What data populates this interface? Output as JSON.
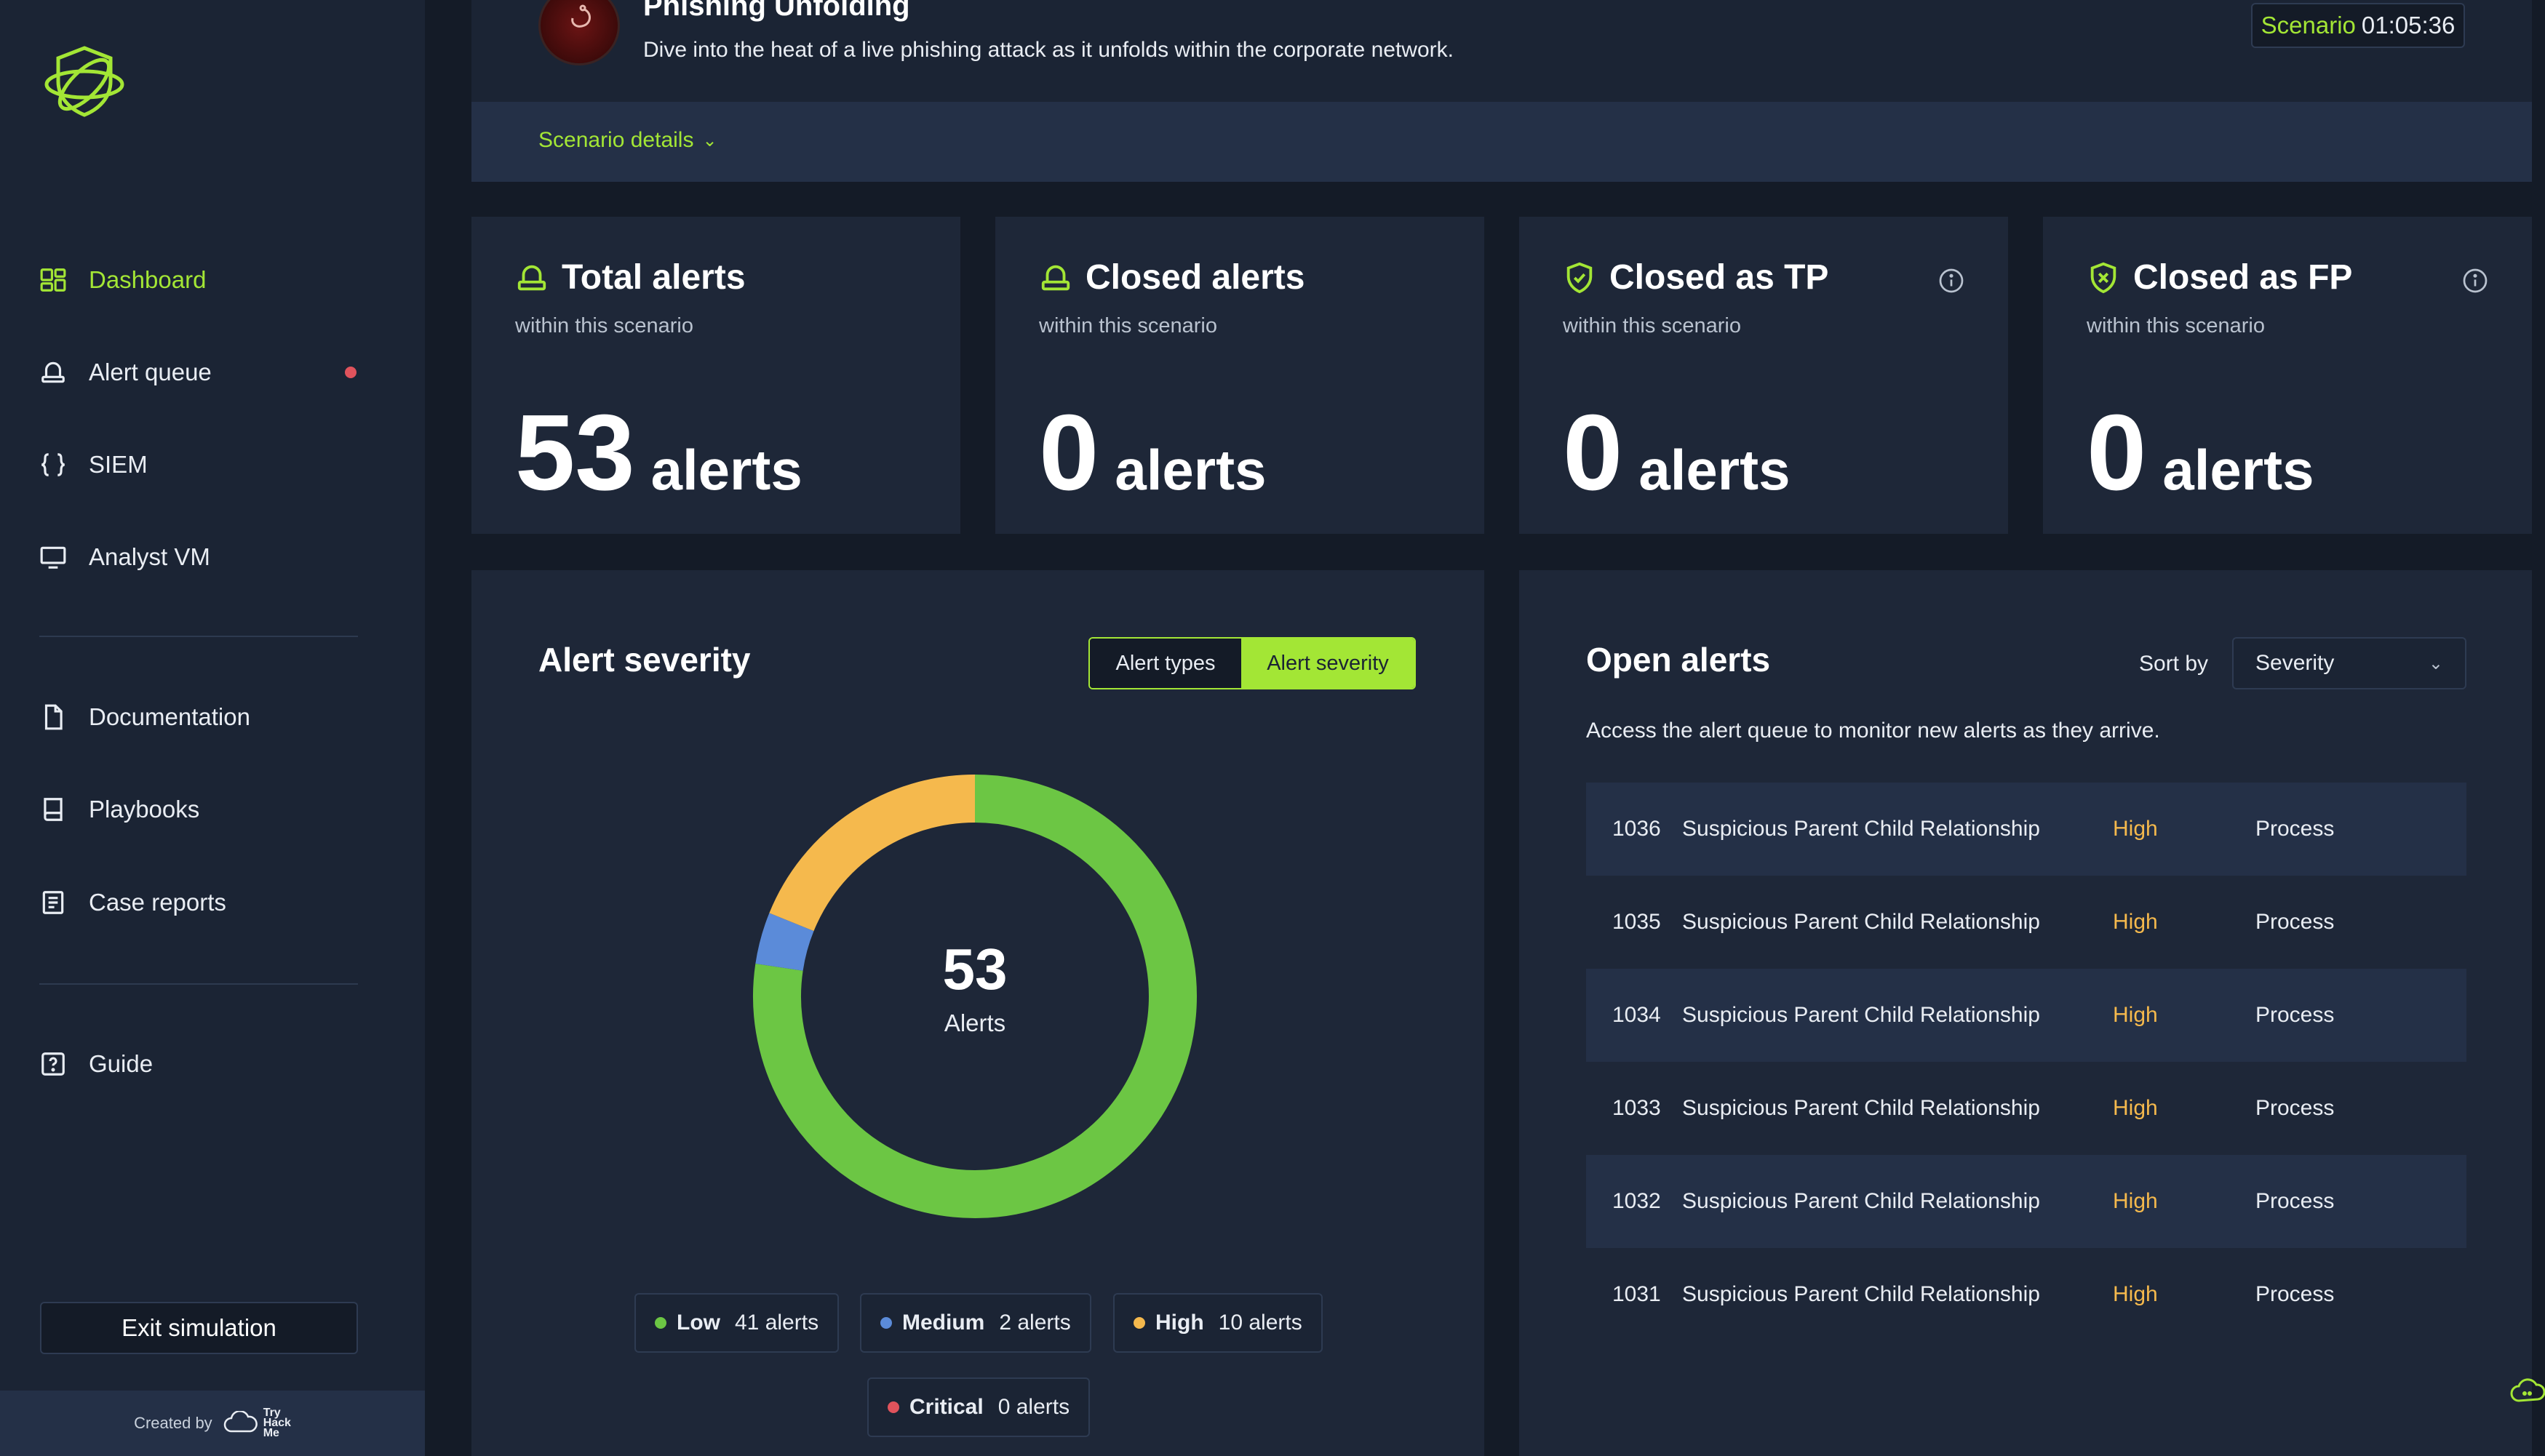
{
  "sidebar": {
    "nav_primary": [
      {
        "label": "Dashboard",
        "icon": "dashboard-icon",
        "active": true
      },
      {
        "label": "Alert queue",
        "icon": "alert-queue-icon",
        "notify": true
      },
      {
        "label": "SIEM",
        "icon": "braces-icon"
      },
      {
        "label": "Analyst VM",
        "icon": "monitor-icon"
      }
    ],
    "nav_secondary": [
      {
        "label": "Documentation",
        "icon": "document-icon"
      },
      {
        "label": "Playbooks",
        "icon": "book-icon"
      },
      {
        "label": "Case reports",
        "icon": "report-icon"
      }
    ],
    "nav_tertiary": [
      {
        "label": "Guide",
        "icon": "help-icon"
      }
    ],
    "exit_label": "Exit simulation",
    "footer_created_by": "Created by",
    "footer_brand": [
      "Try",
      "Hack",
      "Me"
    ]
  },
  "header": {
    "scenario_title": "Phishing Unfolding",
    "scenario_description": "Dive into the heat of a live phishing attack as it unfolds within the corporate network.",
    "timer_label": "Scenario",
    "timer_value": "01:05:36",
    "details_label": "Scenario details"
  },
  "stats": [
    {
      "title": "Total alerts",
      "subtitle": "within this scenario",
      "value": "53",
      "unit": "alerts",
      "icon": "alert-light-icon",
      "info": false
    },
    {
      "title": "Closed alerts",
      "subtitle": "within this scenario",
      "value": "0",
      "unit": "alerts",
      "icon": "alert-light-icon",
      "info": false
    },
    {
      "title": "Closed as TP",
      "subtitle": "within this scenario",
      "value": "0",
      "unit": "alerts",
      "icon": "shield-check-icon",
      "info": true
    },
    {
      "title": "Closed as FP",
      "subtitle": "within this scenario",
      "value": "0",
      "unit": "alerts",
      "icon": "shield-x-icon",
      "info": true
    }
  ],
  "severity_panel": {
    "title": "Alert severity",
    "toggle_options": [
      "Alert types",
      "Alert severity"
    ],
    "toggle_selected": "Alert severity",
    "center_value": "53",
    "center_label": "Alerts"
  },
  "chart_data": {
    "type": "pie",
    "total": 53,
    "series": [
      {
        "name": "Low",
        "value": 41,
        "label": "41 alerts",
        "color": "#6cc644"
      },
      {
        "name": "Medium",
        "value": 2,
        "label": "2 alerts",
        "color": "#5b8bd9"
      },
      {
        "name": "High",
        "value": 10,
        "label": "10 alerts",
        "color": "#f5b94d"
      },
      {
        "name": "Critical",
        "value": 0,
        "label": "0 alerts",
        "color": "#e0535c"
      }
    ]
  },
  "open_alerts": {
    "title": "Open alerts",
    "sort_label": "Sort by",
    "sort_value": "Severity",
    "description": "Access the alert queue to monitor new alerts as they arrive.",
    "rows": [
      {
        "id": "1036",
        "name": "Suspicious Parent Child Relationship",
        "severity": "High",
        "type": "Process"
      },
      {
        "id": "1035",
        "name": "Suspicious Parent Child Relationship",
        "severity": "High",
        "type": "Process"
      },
      {
        "id": "1034",
        "name": "Suspicious Parent Child Relationship",
        "severity": "High",
        "type": "Process"
      },
      {
        "id": "1033",
        "name": "Suspicious Parent Child Relationship",
        "severity": "High",
        "type": "Process"
      },
      {
        "id": "1032",
        "name": "Suspicious Parent Child Relationship",
        "severity": "High",
        "type": "Process"
      },
      {
        "id": "1031",
        "name": "Suspicious Parent Child Relationship",
        "severity": "High",
        "type": "Process"
      }
    ]
  },
  "colors": {
    "accent": "#a3e635",
    "high": "#f5b94d",
    "alert_dot": "#e0535c"
  }
}
